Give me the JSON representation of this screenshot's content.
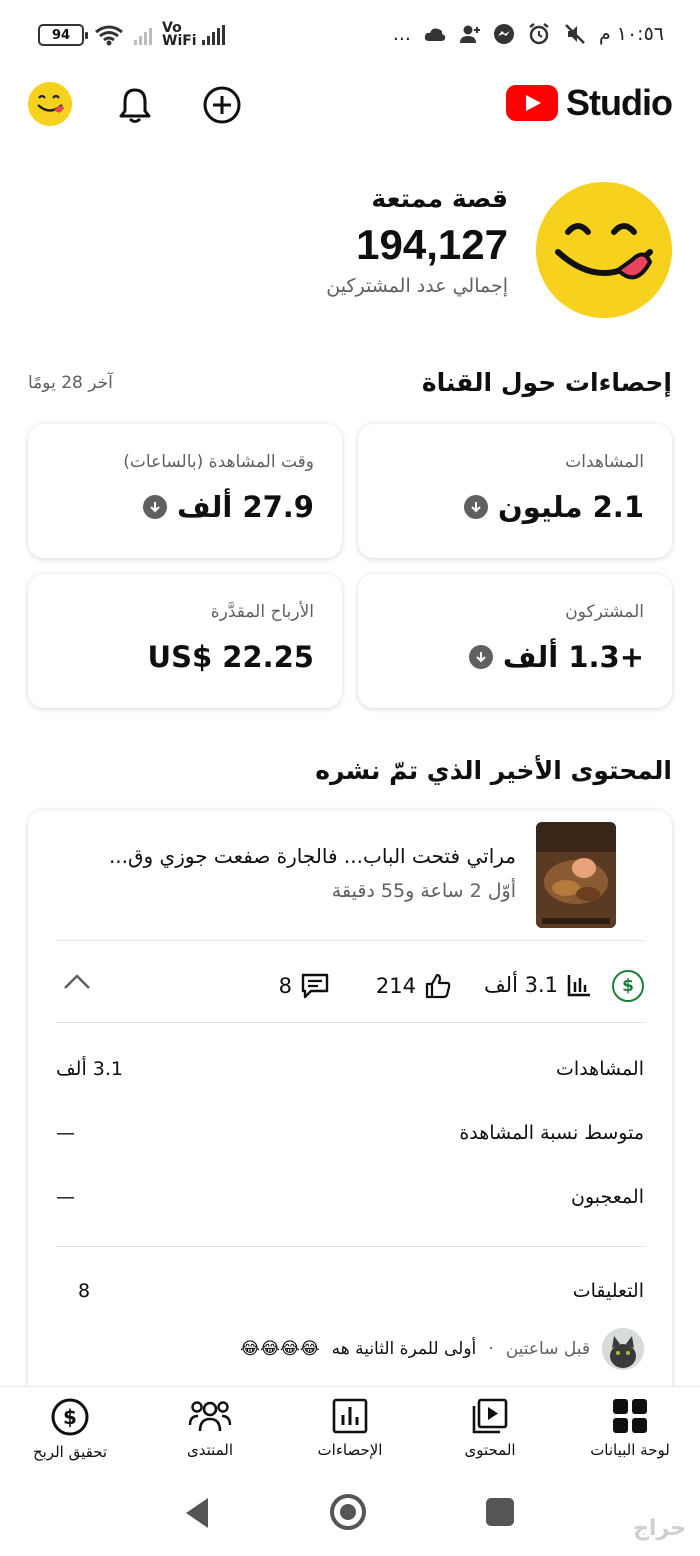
{
  "status_bar": {
    "battery": "94",
    "network": "Vo WiFi",
    "time": "١٠:٥٦ م",
    "more": "..."
  },
  "header": {
    "logo_text": "Studio",
    "icons": [
      "avatar-face",
      "bell-icon",
      "add-circle-icon",
      "youtube-logo"
    ]
  },
  "channel": {
    "name": "قصة ممتعة",
    "subscriber_count": "194,127",
    "subscriber_label": "إجمالي عدد المشتركين"
  },
  "analytics": {
    "title": "إحصاءات حول القناة",
    "period": "آخر 28 يومًا",
    "cards": [
      {
        "label": "المشاهدات",
        "value": "2.1 مليون",
        "trend": "down"
      },
      {
        "label": "وقت المشاهدة (بالساعات)",
        "value": "27.9 ألف",
        "trend": "down"
      },
      {
        "label": "المشتركون",
        "value": "+1.3 ألف",
        "trend": "down"
      },
      {
        "label": "الأرباح المقدَّرة",
        "value": "US$ 22.25",
        "trend": ""
      }
    ]
  },
  "recent": {
    "title": "المحتوى الأخير الذي تمّ نشره",
    "video_title": "مراتي فتحت الباب... فالجارة صفعت جوزي وق...",
    "video_meta": "أوّل 2 ساعة و55 دقيقة",
    "stats": {
      "views": "3.1 ألف",
      "likes": "214",
      "comments": "8"
    },
    "details": [
      {
        "label": "المشاهدات",
        "value": "3.1 ألف"
      },
      {
        "label": "متوسط نسبة المشاهدة",
        "value": "—"
      },
      {
        "label": "المعجبون",
        "value": "—"
      },
      {
        "label": "التعليقات",
        "value": "8"
      }
    ],
    "comment": {
      "time": "قبل ساعتين",
      "separator": "·",
      "text": "أولى للمرة الثانية هه",
      "emoji": "😂😂😂😂"
    }
  },
  "bottom_nav": [
    {
      "label": "لوحة البيانات",
      "icon": "dashboard-icon"
    },
    {
      "label": "المحتوى",
      "icon": "content-icon"
    },
    {
      "label": "الإحصاءات",
      "icon": "analytics-icon"
    },
    {
      "label": "المنتدى",
      "icon": "community-icon"
    },
    {
      "label": "تحقيق الربح",
      "icon": "monetization-icon"
    }
  ],
  "watermark": "حراج",
  "colors": {
    "brand": "#ff0000",
    "avatar_yellow": "#f6d21e",
    "money_green": "#1a7f37",
    "muted": "#606060"
  }
}
